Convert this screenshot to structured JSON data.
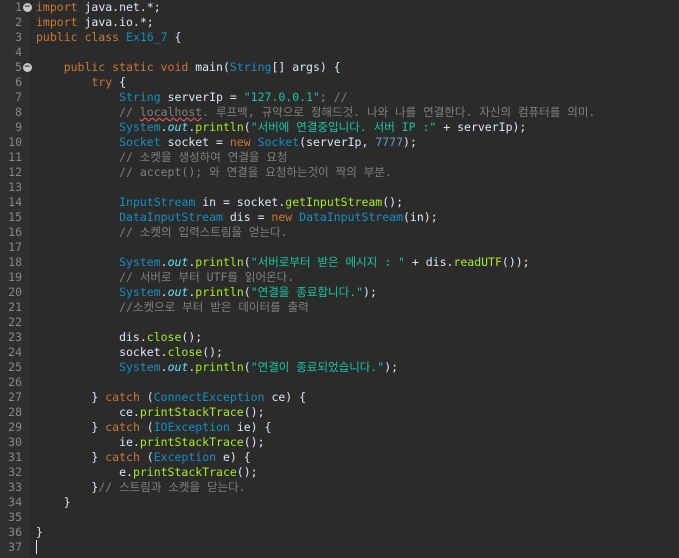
{
  "lines": [
    {
      "n": "1",
      "fold": true,
      "tokens": [
        {
          "t": "import",
          "c": "k"
        },
        {
          "t": " java.net.*;",
          "c": "t"
        }
      ]
    },
    {
      "n": "2",
      "tokens": [
        {
          "t": "import",
          "c": "k"
        },
        {
          "t": " java.io.*;",
          "c": "t"
        }
      ]
    },
    {
      "n": "3",
      "tokens": [
        {
          "t": "public class ",
          "c": "k"
        },
        {
          "t": "Ex16_7",
          "c": "cl"
        },
        {
          "t": " {",
          "c": "t"
        }
      ]
    },
    {
      "n": "4",
      "tokens": []
    },
    {
      "n": "5",
      "fold": true,
      "tokens": [
        {
          "t": "    public static void ",
          "c": "k"
        },
        {
          "t": "main",
          "c": "f"
        },
        {
          "t": "(",
          "c": "o"
        },
        {
          "t": "String",
          "c": "ty"
        },
        {
          "t": "[] args) {",
          "c": "t"
        }
      ]
    },
    {
      "n": "6",
      "tokens": [
        {
          "t": "        try",
          "c": "k"
        },
        {
          "t": " {",
          "c": "t"
        }
      ]
    },
    {
      "n": "7",
      "tokens": [
        {
          "t": "            ",
          "c": "t"
        },
        {
          "t": "String",
          "c": "ty"
        },
        {
          "t": " serverIp = ",
          "c": "t"
        },
        {
          "t": "\"127.0.0.1\"",
          "c": "s"
        },
        {
          "t": "; //",
          "c": "c"
        }
      ]
    },
    {
      "n": "8",
      "tokens": [
        {
          "t": "            // ",
          "c": "c"
        },
        {
          "t": "localhost",
          "c": "w"
        },
        {
          "t": ". 루프백, 규약으로 정해드것. 나와 나를 연결한다. 자신의 컴퓨터를 의미.",
          "c": "c"
        }
      ]
    },
    {
      "n": "9",
      "tokens": [
        {
          "t": "            ",
          "c": "t"
        },
        {
          "t": "System",
          "c": "ty"
        },
        {
          "t": ".",
          "c": "o"
        },
        {
          "t": "out",
          "c": "st"
        },
        {
          "t": ".",
          "c": "o"
        },
        {
          "t": "println",
          "c": "mt"
        },
        {
          "t": "(",
          "c": "o"
        },
        {
          "t": "\"서버에 연결중입니다. 서버 IP :\"",
          "c": "s"
        },
        {
          "t": " + serverIp);",
          "c": "t"
        }
      ]
    },
    {
      "n": "10",
      "tokens": [
        {
          "t": "            ",
          "c": "t"
        },
        {
          "t": "Socket",
          "c": "ty"
        },
        {
          "t": " socket = ",
          "c": "t"
        },
        {
          "t": "new",
          "c": "k"
        },
        {
          "t": " ",
          "c": "t"
        },
        {
          "t": "Socket",
          "c": "ty"
        },
        {
          "t": "(serverIp, ",
          "c": "t"
        },
        {
          "t": "7777",
          "c": "nm"
        },
        {
          "t": ");",
          "c": "t"
        }
      ]
    },
    {
      "n": "11",
      "tokens": [
        {
          "t": "            // 소켓을 생성하여 연결을 요청",
          "c": "c"
        }
      ]
    },
    {
      "n": "12",
      "tokens": [
        {
          "t": "            // accept(); 와 연결을 요청하는것이 짝의 부분.",
          "c": "c"
        }
      ]
    },
    {
      "n": "13",
      "tokens": []
    },
    {
      "n": "14",
      "tokens": [
        {
          "t": "            ",
          "c": "t"
        },
        {
          "t": "InputStream",
          "c": "ty"
        },
        {
          "t": " in = socket.",
          "c": "t"
        },
        {
          "t": "getInputStream",
          "c": "mt"
        },
        {
          "t": "();",
          "c": "t"
        }
      ]
    },
    {
      "n": "15",
      "tokens": [
        {
          "t": "            ",
          "c": "t"
        },
        {
          "t": "DataInputStream",
          "c": "ty"
        },
        {
          "t": " dis = ",
          "c": "t"
        },
        {
          "t": "new",
          "c": "k"
        },
        {
          "t": " ",
          "c": "t"
        },
        {
          "t": "DataInputStream",
          "c": "ty"
        },
        {
          "t": "(in);",
          "c": "t"
        }
      ]
    },
    {
      "n": "16",
      "tokens": [
        {
          "t": "            // 소켓의 입력스트림을 얻는다.",
          "c": "c"
        }
      ]
    },
    {
      "n": "17",
      "tokens": []
    },
    {
      "n": "18",
      "tokens": [
        {
          "t": "            ",
          "c": "t"
        },
        {
          "t": "System",
          "c": "ty"
        },
        {
          "t": ".",
          "c": "o"
        },
        {
          "t": "out",
          "c": "st"
        },
        {
          "t": ".",
          "c": "o"
        },
        {
          "t": "println",
          "c": "mt"
        },
        {
          "t": "(",
          "c": "o"
        },
        {
          "t": "\"서버로부터 받은 메시지 : \"",
          "c": "s"
        },
        {
          "t": " + dis.",
          "c": "t"
        },
        {
          "t": "readUTF",
          "c": "mt"
        },
        {
          "t": "());",
          "c": "t"
        }
      ]
    },
    {
      "n": "19",
      "tokens": [
        {
          "t": "            // 서버로 부터 UTF를 읽어온다.",
          "c": "c"
        }
      ]
    },
    {
      "n": "20",
      "tokens": [
        {
          "t": "            ",
          "c": "t"
        },
        {
          "t": "System",
          "c": "ty"
        },
        {
          "t": ".",
          "c": "o"
        },
        {
          "t": "out",
          "c": "st"
        },
        {
          "t": ".",
          "c": "o"
        },
        {
          "t": "println",
          "c": "mt"
        },
        {
          "t": "(",
          "c": "o"
        },
        {
          "t": "\"연결을 종료합니다.\"",
          "c": "s"
        },
        {
          "t": ");",
          "c": "t"
        }
      ]
    },
    {
      "n": "21",
      "tokens": [
        {
          "t": "            //소켓으로 부터 받은 데이터를 출력",
          "c": "c"
        }
      ]
    },
    {
      "n": "22",
      "tokens": []
    },
    {
      "n": "23",
      "tokens": [
        {
          "t": "            dis.",
          "c": "t"
        },
        {
          "t": "close",
          "c": "mt"
        },
        {
          "t": "();",
          "c": "t"
        }
      ]
    },
    {
      "n": "24",
      "tokens": [
        {
          "t": "            socket.",
          "c": "t"
        },
        {
          "t": "close",
          "c": "mt"
        },
        {
          "t": "();",
          "c": "t"
        }
      ]
    },
    {
      "n": "25",
      "tokens": [
        {
          "t": "            ",
          "c": "t"
        },
        {
          "t": "System",
          "c": "ty"
        },
        {
          "t": ".",
          "c": "o"
        },
        {
          "t": "out",
          "c": "st"
        },
        {
          "t": ".",
          "c": "o"
        },
        {
          "t": "println",
          "c": "mt"
        },
        {
          "t": "(",
          "c": "o"
        },
        {
          "t": "\"연결이 종료되었습니다.\"",
          "c": "s"
        },
        {
          "t": ");",
          "c": "t"
        }
      ]
    },
    {
      "n": "26",
      "tokens": []
    },
    {
      "n": "27",
      "tokens": [
        {
          "t": "        } ",
          "c": "t"
        },
        {
          "t": "catch",
          "c": "k"
        },
        {
          "t": " (",
          "c": "t"
        },
        {
          "t": "ConnectException",
          "c": "ty"
        },
        {
          "t": " ce) {",
          "c": "t"
        }
      ]
    },
    {
      "n": "28",
      "tokens": [
        {
          "t": "            ce.",
          "c": "t"
        },
        {
          "t": "printStackTrace",
          "c": "mt"
        },
        {
          "t": "();",
          "c": "t"
        }
      ]
    },
    {
      "n": "29",
      "tokens": [
        {
          "t": "        } ",
          "c": "t"
        },
        {
          "t": "catch",
          "c": "k"
        },
        {
          "t": " (",
          "c": "t"
        },
        {
          "t": "IOException",
          "c": "ty"
        },
        {
          "t": " ie) {",
          "c": "t"
        }
      ]
    },
    {
      "n": "30",
      "tokens": [
        {
          "t": "            ie.",
          "c": "t"
        },
        {
          "t": "printStackTrace",
          "c": "mt"
        },
        {
          "t": "();",
          "c": "t"
        }
      ]
    },
    {
      "n": "31",
      "tokens": [
        {
          "t": "        } ",
          "c": "t"
        },
        {
          "t": "catch",
          "c": "k"
        },
        {
          "t": " (",
          "c": "t"
        },
        {
          "t": "Exception",
          "c": "ty"
        },
        {
          "t": " e) {",
          "c": "t"
        }
      ]
    },
    {
      "n": "32",
      "tokens": [
        {
          "t": "            e.",
          "c": "t"
        },
        {
          "t": "printStackTrace",
          "c": "mt"
        },
        {
          "t": "();",
          "c": "t"
        }
      ]
    },
    {
      "n": "33",
      "tokens": [
        {
          "t": "        }",
          "c": "t"
        },
        {
          "t": "// 스트림과 소켓을 닫는다.",
          "c": "c"
        }
      ]
    },
    {
      "n": "34",
      "tokens": [
        {
          "t": "    }",
          "c": "t"
        }
      ]
    },
    {
      "n": "35",
      "tokens": []
    },
    {
      "n": "36",
      "tokens": [
        {
          "t": "}",
          "c": "t"
        }
      ]
    },
    {
      "n": "37",
      "tokens": []
    }
  ]
}
